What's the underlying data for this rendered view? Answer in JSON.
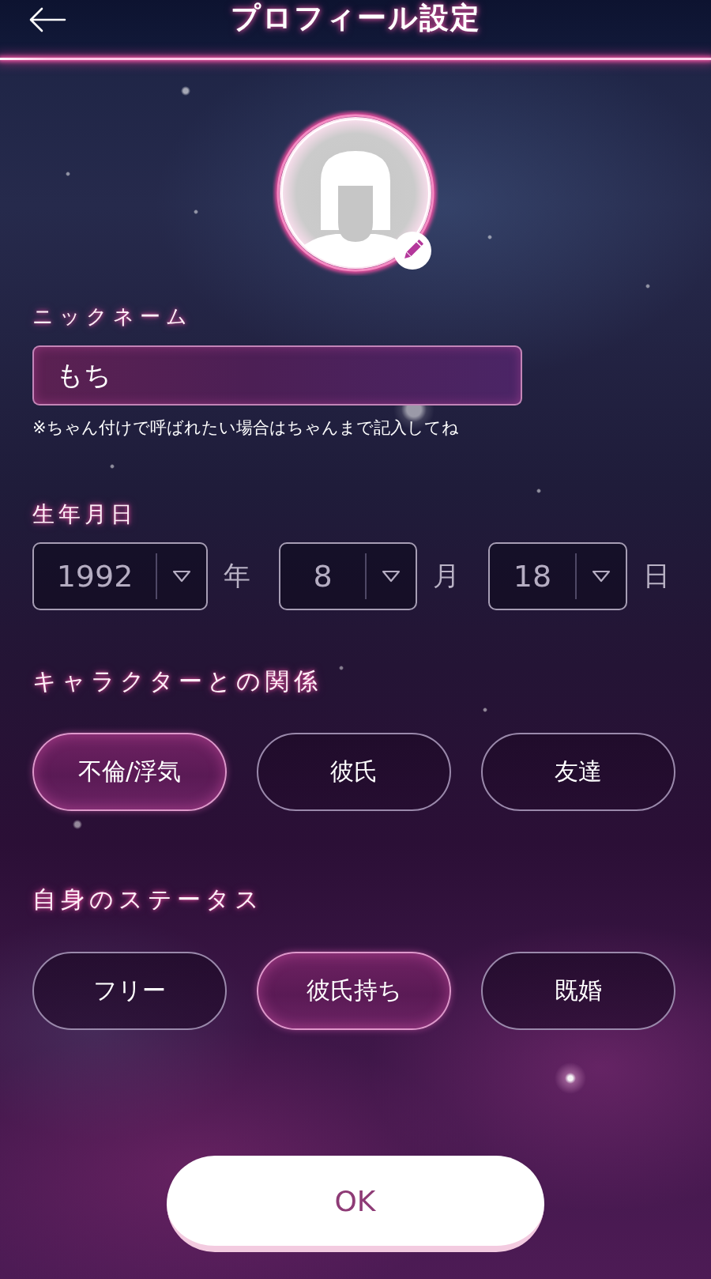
{
  "header": {
    "title": "プロフィール設定"
  },
  "nickname": {
    "label": "ニックネーム",
    "value": "もち",
    "note": "※ちゃん付けで呼ばれたい場合はちゃんまで記入してね"
  },
  "birthday": {
    "label": "生年月日",
    "fields": [
      {
        "value": "1992",
        "unit": "年"
      },
      {
        "value": "8",
        "unit": "月"
      },
      {
        "value": "18",
        "unit": "日"
      }
    ]
  },
  "relationship": {
    "label": "キャラクターとの関係",
    "options": [
      {
        "label": "不倫/浮気",
        "selected": true
      },
      {
        "label": "彼氏",
        "selected": false
      },
      {
        "label": "友達",
        "selected": false
      }
    ]
  },
  "status": {
    "label": "自身のステータス",
    "options": [
      {
        "label": "フリー",
        "selected": false
      },
      {
        "label": "彼氏持ち",
        "selected": true
      },
      {
        "label": "既婚",
        "selected": false
      }
    ]
  },
  "ok_button": {
    "label": "OK"
  }
}
